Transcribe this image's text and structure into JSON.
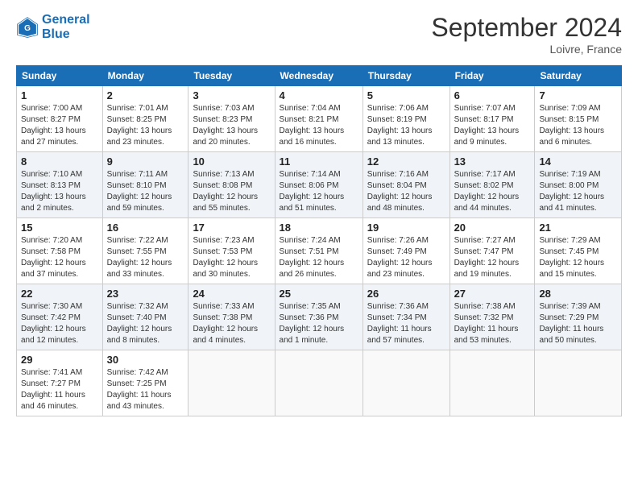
{
  "header": {
    "logo_line1": "General",
    "logo_line2": "Blue",
    "month_title": "September 2024",
    "location": "Loivre, France"
  },
  "weekdays": [
    "Sunday",
    "Monday",
    "Tuesday",
    "Wednesday",
    "Thursday",
    "Friday",
    "Saturday"
  ],
  "weeks": [
    [
      {
        "day": "1",
        "info": "Sunrise: 7:00 AM\nSunset: 8:27 PM\nDaylight: 13 hours\nand 27 minutes."
      },
      {
        "day": "2",
        "info": "Sunrise: 7:01 AM\nSunset: 8:25 PM\nDaylight: 13 hours\nand 23 minutes."
      },
      {
        "day": "3",
        "info": "Sunrise: 7:03 AM\nSunset: 8:23 PM\nDaylight: 13 hours\nand 20 minutes."
      },
      {
        "day": "4",
        "info": "Sunrise: 7:04 AM\nSunset: 8:21 PM\nDaylight: 13 hours\nand 16 minutes."
      },
      {
        "day": "5",
        "info": "Sunrise: 7:06 AM\nSunset: 8:19 PM\nDaylight: 13 hours\nand 13 minutes."
      },
      {
        "day": "6",
        "info": "Sunrise: 7:07 AM\nSunset: 8:17 PM\nDaylight: 13 hours\nand 9 minutes."
      },
      {
        "day": "7",
        "info": "Sunrise: 7:09 AM\nSunset: 8:15 PM\nDaylight: 13 hours\nand 6 minutes."
      }
    ],
    [
      {
        "day": "8",
        "info": "Sunrise: 7:10 AM\nSunset: 8:13 PM\nDaylight: 13 hours\nand 2 minutes."
      },
      {
        "day": "9",
        "info": "Sunrise: 7:11 AM\nSunset: 8:10 PM\nDaylight: 12 hours\nand 59 minutes."
      },
      {
        "day": "10",
        "info": "Sunrise: 7:13 AM\nSunset: 8:08 PM\nDaylight: 12 hours\nand 55 minutes."
      },
      {
        "day": "11",
        "info": "Sunrise: 7:14 AM\nSunset: 8:06 PM\nDaylight: 12 hours\nand 51 minutes."
      },
      {
        "day": "12",
        "info": "Sunrise: 7:16 AM\nSunset: 8:04 PM\nDaylight: 12 hours\nand 48 minutes."
      },
      {
        "day": "13",
        "info": "Sunrise: 7:17 AM\nSunset: 8:02 PM\nDaylight: 12 hours\nand 44 minutes."
      },
      {
        "day": "14",
        "info": "Sunrise: 7:19 AM\nSunset: 8:00 PM\nDaylight: 12 hours\nand 41 minutes."
      }
    ],
    [
      {
        "day": "15",
        "info": "Sunrise: 7:20 AM\nSunset: 7:58 PM\nDaylight: 12 hours\nand 37 minutes."
      },
      {
        "day": "16",
        "info": "Sunrise: 7:22 AM\nSunset: 7:55 PM\nDaylight: 12 hours\nand 33 minutes."
      },
      {
        "day": "17",
        "info": "Sunrise: 7:23 AM\nSunset: 7:53 PM\nDaylight: 12 hours\nand 30 minutes."
      },
      {
        "day": "18",
        "info": "Sunrise: 7:24 AM\nSunset: 7:51 PM\nDaylight: 12 hours\nand 26 minutes."
      },
      {
        "day": "19",
        "info": "Sunrise: 7:26 AM\nSunset: 7:49 PM\nDaylight: 12 hours\nand 23 minutes."
      },
      {
        "day": "20",
        "info": "Sunrise: 7:27 AM\nSunset: 7:47 PM\nDaylight: 12 hours\nand 19 minutes."
      },
      {
        "day": "21",
        "info": "Sunrise: 7:29 AM\nSunset: 7:45 PM\nDaylight: 12 hours\nand 15 minutes."
      }
    ],
    [
      {
        "day": "22",
        "info": "Sunrise: 7:30 AM\nSunset: 7:42 PM\nDaylight: 12 hours\nand 12 minutes."
      },
      {
        "day": "23",
        "info": "Sunrise: 7:32 AM\nSunset: 7:40 PM\nDaylight: 12 hours\nand 8 minutes."
      },
      {
        "day": "24",
        "info": "Sunrise: 7:33 AM\nSunset: 7:38 PM\nDaylight: 12 hours\nand 4 minutes."
      },
      {
        "day": "25",
        "info": "Sunrise: 7:35 AM\nSunset: 7:36 PM\nDaylight: 12 hours\nand 1 minute."
      },
      {
        "day": "26",
        "info": "Sunrise: 7:36 AM\nSunset: 7:34 PM\nDaylight: 11 hours\nand 57 minutes."
      },
      {
        "day": "27",
        "info": "Sunrise: 7:38 AM\nSunset: 7:32 PM\nDaylight: 11 hours\nand 53 minutes."
      },
      {
        "day": "28",
        "info": "Sunrise: 7:39 AM\nSunset: 7:29 PM\nDaylight: 11 hours\nand 50 minutes."
      }
    ],
    [
      {
        "day": "29",
        "info": "Sunrise: 7:41 AM\nSunset: 7:27 PM\nDaylight: 11 hours\nand 46 minutes."
      },
      {
        "day": "30",
        "info": "Sunrise: 7:42 AM\nSunset: 7:25 PM\nDaylight: 11 hours\nand 43 minutes."
      },
      {
        "day": "",
        "info": ""
      },
      {
        "day": "",
        "info": ""
      },
      {
        "day": "",
        "info": ""
      },
      {
        "day": "",
        "info": ""
      },
      {
        "day": "",
        "info": ""
      }
    ]
  ]
}
